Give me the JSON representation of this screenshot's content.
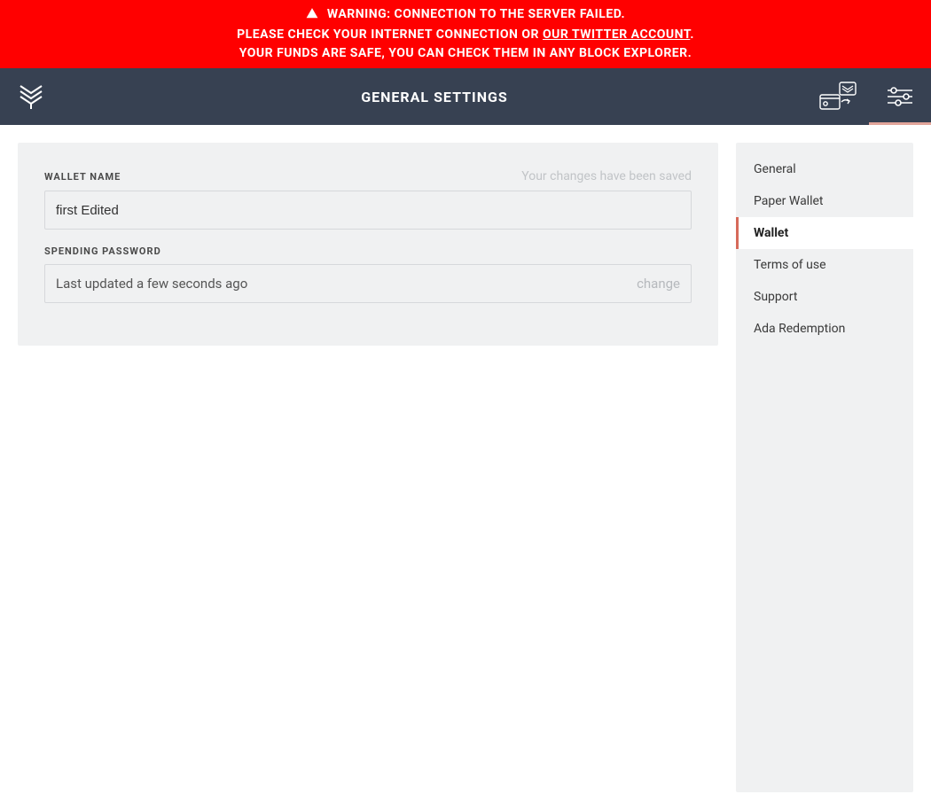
{
  "banner": {
    "line1": "WARNING: CONNECTION TO THE SERVER FAILED.",
    "line2_prefix": "PLEASE CHECK YOUR INTERNET CONNECTION OR ",
    "line2_link": "OUR TWITTER ACCOUNT",
    "line2_suffix": ".",
    "line3": "YOUR FUNDS ARE SAFE, YOU CAN CHECK THEM IN ANY BLOCK EXPLORER."
  },
  "header": {
    "title": "GENERAL SETTINGS"
  },
  "main": {
    "wallet_name": {
      "label": "WALLET NAME",
      "value": "first Edited",
      "saved_message": "Your changes have been saved"
    },
    "spending_password": {
      "label": "SPENDING PASSWORD",
      "status": "Last updated a few seconds ago",
      "action": "change"
    }
  },
  "sidebar": {
    "items": [
      {
        "label": "General",
        "active": false
      },
      {
        "label": "Paper Wallet",
        "active": false
      },
      {
        "label": "Wallet",
        "active": true
      },
      {
        "label": "Terms of use",
        "active": false
      },
      {
        "label": "Support",
        "active": false
      },
      {
        "label": "Ada Redemption",
        "active": false
      }
    ]
  },
  "colors": {
    "banner_bg": "#ff0000",
    "topbar_bg": "#374152",
    "accent": "#d66a5a",
    "panel_bg": "#f0f1f2"
  }
}
